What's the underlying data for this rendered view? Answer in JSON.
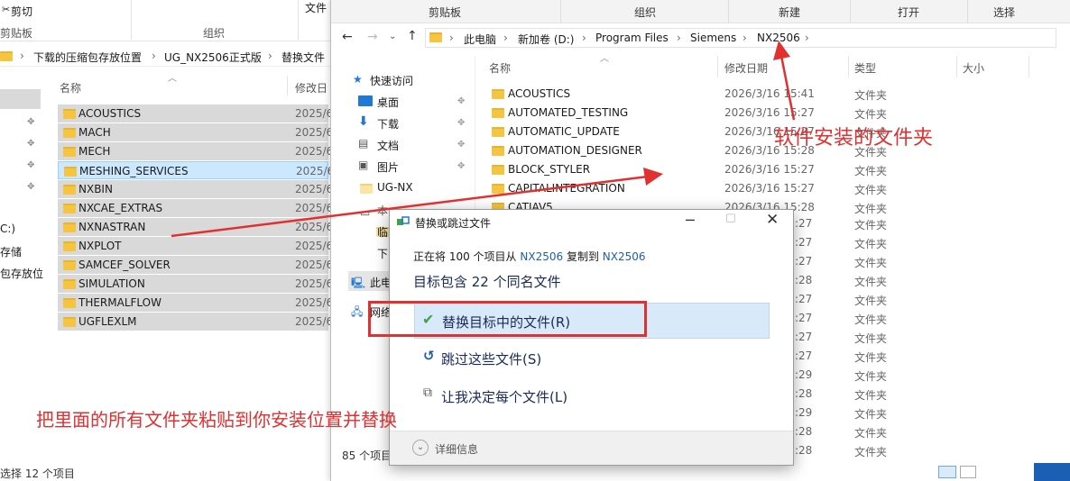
{
  "left_window": {
    "ribbon": {
      "cut": "剪切",
      "clipboard": "剪贴板",
      "organize": "组织",
      "file_trunc": "文件"
    },
    "breadcrumb": [
      "下载的压缩包存放位置",
      "UG_NX2506正式版",
      "替换文件"
    ],
    "col_name": "名称",
    "col_date": "修改日",
    "rows": [
      {
        "name": "ACOUSTICS",
        "date": "2025/6"
      },
      {
        "name": "MACH",
        "date": "2025/6"
      },
      {
        "name": "MECH",
        "date": "2025/6"
      },
      {
        "name": "MESHING_SERVICES",
        "date": "2025/6"
      },
      {
        "name": "NXBIN",
        "date": "2025/6"
      },
      {
        "name": "NXCAE_EXTRAS",
        "date": "2025/6"
      },
      {
        "name": "NXNASTRAN",
        "date": "2025/6"
      },
      {
        "name": "NXPLOT",
        "date": "2025/6"
      },
      {
        "name": "SAMCEF_SOLVER",
        "date": "2025/6"
      },
      {
        "name": "SIMULATION",
        "date": "2025/6"
      },
      {
        "name": "THERMALFLOW",
        "date": "2025/6"
      },
      {
        "name": "UGFLEXLM",
        "date": "2025/6"
      }
    ],
    "side_fragments": [
      "C:)",
      "存储",
      "包存放位"
    ],
    "status": "选择 12 个项目"
  },
  "right_window": {
    "ribbon": {
      "clipboard": "剪贴板",
      "organize": "组织",
      "new": "新建",
      "open": "打开",
      "select": "选择"
    },
    "breadcrumb": [
      "此电脑",
      "新加卷 (D:)",
      "Program Files",
      "Siemens",
      "NX2506"
    ],
    "nav": {
      "quick_access": "快速访问",
      "desktop": "桌面",
      "downloads": "下载",
      "documents": "文档",
      "pictures": "图片",
      "ug_nx": "UG-NX",
      "local_c": "本地磁盘 (C:)",
      "temp": "临时",
      "down2": "下",
      "this_pc": "此电",
      "network": "网络"
    },
    "columns": {
      "name": "名称",
      "date": "修改日期",
      "type": "类型",
      "size": "大小"
    },
    "rows": [
      {
        "name": "ACOUSTICS",
        "date": "2026/3/16 15:41",
        "type": "文件夹"
      },
      {
        "name": "AUTOMATED_TESTING",
        "date": "2026/3/16 15:27",
        "type": "文件夹"
      },
      {
        "name": "AUTOMATIC_UPDATE",
        "date": "2026/3/16 15:27",
        "type": "文件夹"
      },
      {
        "name": "AUTOMATION_DESIGNER",
        "date": "2026/3/16 15:28",
        "type": "文件夹"
      },
      {
        "name": "BLOCK_STYLER",
        "date": "2026/3/16 15:27",
        "type": "文件夹"
      },
      {
        "name": "CAPITALINTEGRATION",
        "date": "2026/3/16 15:27",
        "type": "文件夹"
      },
      {
        "name": "CATIAV5",
        "date": "2026/3/16 15:28",
        "type": "文件夹"
      }
    ],
    "partial_times": [
      ":27",
      ":27",
      ":27",
      ":28",
      ":27",
      ":27",
      ":27",
      ":27",
      ":29",
      ":28",
      ":29",
      ":28",
      ":28"
    ],
    "partial_types": [
      "文件夹",
      "文件夹",
      "文件夹",
      "文件夹",
      "文件夹",
      "文件夹",
      "文件夹",
      "文件夹",
      "文件夹",
      "文件夹",
      "文件夹",
      "文件夹",
      "文件夹"
    ],
    "status": "85 个项目"
  },
  "dialog": {
    "title": "替换或跳过文件",
    "progress_prefix": "正在将 100 个项目从",
    "src": "NX2506",
    "mid": "复制到",
    "dst": "NX2506",
    "headline": "目标包含 22 个同名文件",
    "opt_replace": "替换目标中的文件(R)",
    "opt_skip": "跳过这些文件(S)",
    "opt_decide": "让我决定每个文件(L)",
    "details": "详细信息"
  },
  "annotations": {
    "install_folder": "软件安装的文件夹",
    "instruction": "把里面的所有文件夹粘贴到你安装位置并替换",
    "color": "#e0302f"
  }
}
